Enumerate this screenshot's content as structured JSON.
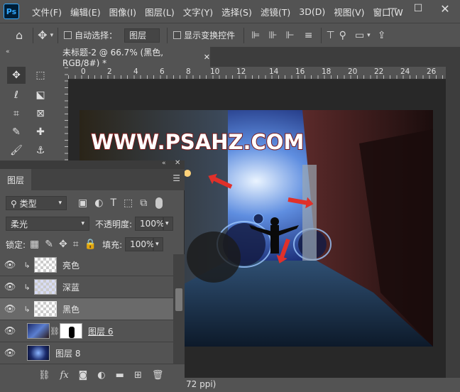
{
  "menu": [
    "文件(F)",
    "编辑(E)",
    "图像(I)",
    "图层(L)",
    "文字(Y)",
    "选择(S)",
    "滤镜(T)",
    "3D(D)",
    "视图(V)",
    "窗口(W"
  ],
  "app_logo": "Ps",
  "options": {
    "auto_select_label": "自动选择：",
    "auto_select_value": "图层",
    "show_transform_label": "显示变换控件"
  },
  "document": {
    "tab_title": "未标题-2 @ 66.7% (黑色, RGB/8#) *",
    "status": "72 ppi)"
  },
  "ruler": {
    "ticks": [
      "0",
      "2",
      "4",
      "6",
      "8",
      "10",
      "12",
      "14",
      "16",
      "18",
      "20",
      "22",
      "24",
      "26"
    ]
  },
  "canvas_text": "WWW.PSAHZ.COM",
  "layers_panel": {
    "tab": "图层",
    "filter_label": "类型",
    "blend_mode": "柔光",
    "opacity_label": "不透明度:",
    "opacity_value": "100%",
    "lock_label": "锁定:",
    "fill_label": "填充:",
    "fill_value": "100%",
    "layers": [
      {
        "name": "亮色"
      },
      {
        "name": "深蓝"
      },
      {
        "name": "黑色"
      },
      {
        "name": "图层 6"
      },
      {
        "name": "图层 8"
      }
    ]
  },
  "colors": {
    "accent": "#31a8ff",
    "panel": "#535353",
    "arrow": "#e0302a"
  }
}
